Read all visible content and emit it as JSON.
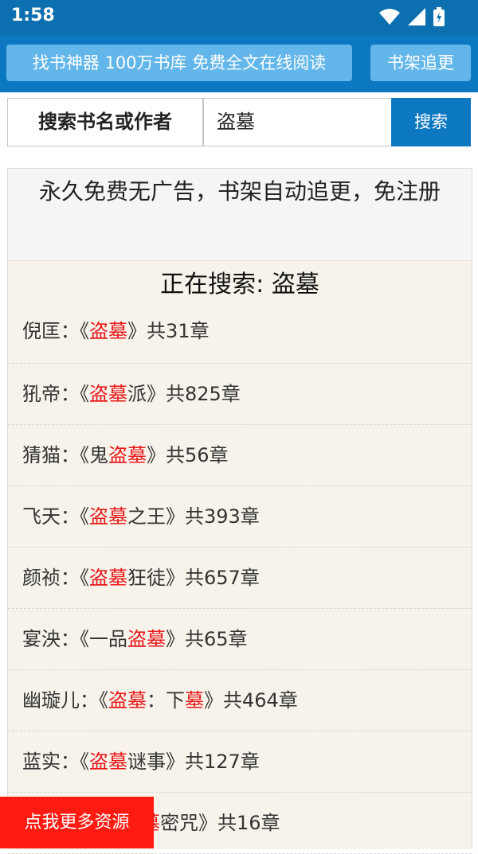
{
  "status_bar": {
    "time": "1:58"
  },
  "header": {
    "banner_label": "找书神器 100万书库 免费全文在线阅读",
    "shelf_label": "书架追更"
  },
  "search": {
    "label": "搜索书名或作者",
    "value": "盗墓",
    "button_label": "搜索"
  },
  "panel": {
    "headline": "永久免费无广告，书架自动追更，免注册",
    "searching_prefix": "正在搜索: ",
    "searching_term": "盗墓"
  },
  "results": [
    {
      "author": "倪匡：",
      "open": "《",
      "pre": "",
      "hl": "盗墓",
      "mid": "",
      "hl2": "",
      "post": "",
      "close": "》",
      "count": "共31章"
    },
    {
      "author": "犼帝：",
      "open": "《",
      "pre": "",
      "hl": "盗墓",
      "mid": "派",
      "hl2": "",
      "post": "",
      "close": "》",
      "count": "共825章"
    },
    {
      "author": "猜猫：",
      "open": "《",
      "pre": "鬼",
      "hl": "盗墓",
      "mid": "",
      "hl2": "",
      "post": "",
      "close": "》",
      "count": "共56章"
    },
    {
      "author": "飞天：",
      "open": "《",
      "pre": "",
      "hl": "盗墓",
      "mid": "之王",
      "hl2": "",
      "post": "",
      "close": "》",
      "count": "共393章"
    },
    {
      "author": "颜祯：",
      "open": "《",
      "pre": "",
      "hl": "盗墓",
      "mid": "狂徒",
      "hl2": "",
      "post": "",
      "close": "》",
      "count": "共657章"
    },
    {
      "author": "宴泱：",
      "open": "《",
      "pre": "一品",
      "hl": "盗墓",
      "mid": "",
      "hl2": "",
      "post": "",
      "close": "》",
      "count": "共65章"
    },
    {
      "author": "幽璇儿：",
      "open": "《",
      "pre": "",
      "hl": "盗墓",
      "mid": "：下",
      "hl2": "墓",
      "post": "",
      "close": "》",
      "count": "共464章"
    },
    {
      "author": "蓝实：",
      "open": "《",
      "pre": "",
      "hl": "盗墓",
      "mid": "谜事",
      "hl2": "",
      "post": "",
      "close": "》",
      "count": "共127章"
    },
    {
      "author": "",
      "open": "",
      "pre": "",
      "hl": "墓",
      "mid": "密咒",
      "hl2": "",
      "post": "",
      "close": "》",
      "count": "共16章"
    }
  ],
  "floating_button": {
    "label": "点我更多资源"
  },
  "colors": {
    "appbar": "#0b78c1",
    "statusbar": "#0b6fb0",
    "highlight": "#e8181b",
    "panel_bg": "#f7f3ea",
    "floating": "#ff1a12"
  },
  "icons": [
    "wifi-icon",
    "signal-icon",
    "battery-icon"
  ]
}
